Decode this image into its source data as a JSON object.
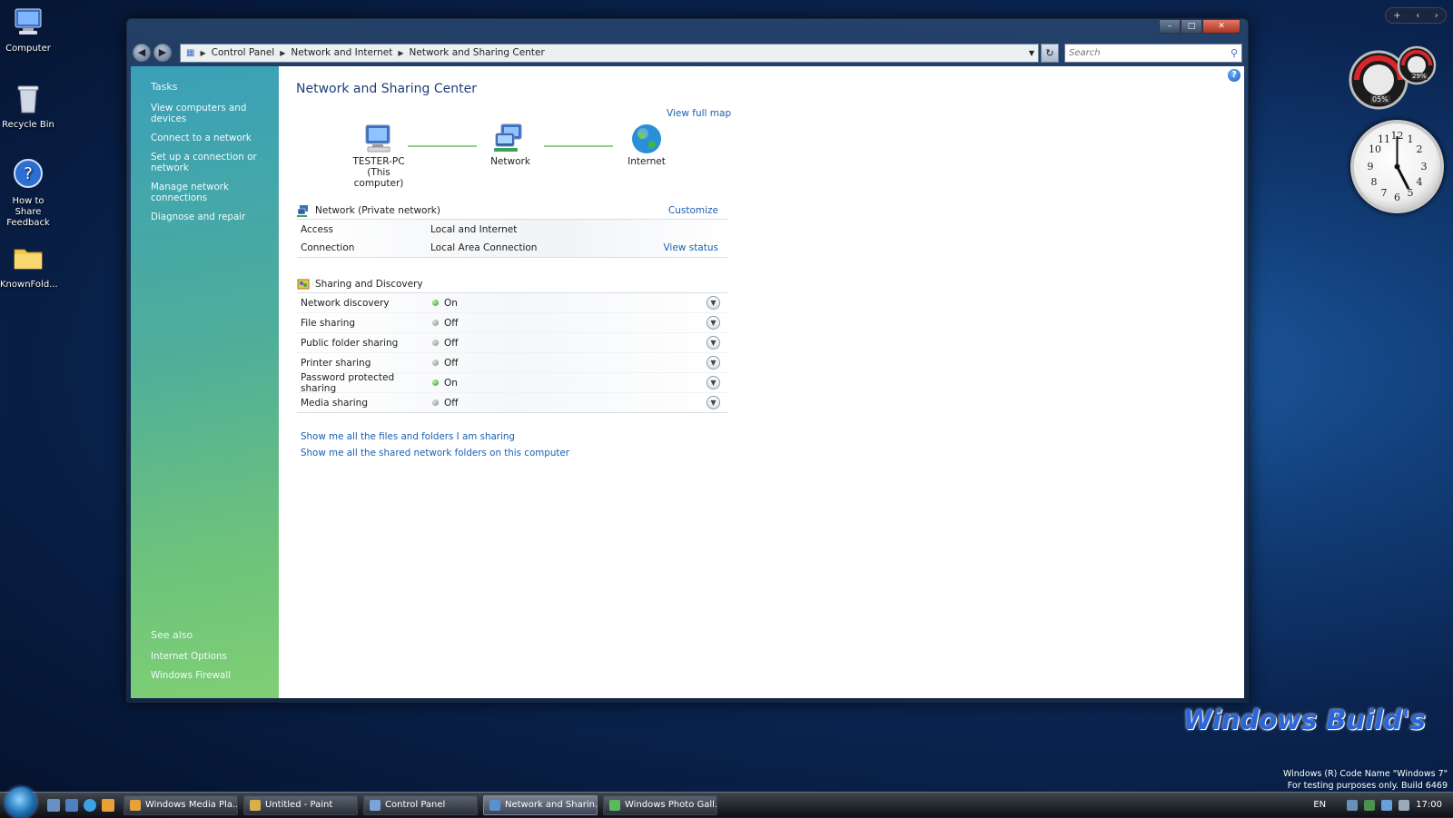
{
  "desktop": {
    "icons": [
      {
        "label": "Computer"
      },
      {
        "label": "Recycle Bin"
      },
      {
        "label": "How to Share Feedback"
      },
      {
        "label": "KnownFold..."
      }
    ]
  },
  "window": {
    "breadcrumb": [
      "Control Panel",
      "Network and Internet",
      "Network and Sharing Center"
    ],
    "search_placeholder": "Search",
    "sidebar": {
      "tasks_heading": "Tasks",
      "tasks": [
        "View computers and devices",
        "Connect to a network",
        "Set up a connection or network",
        "Manage network connections",
        "Diagnose and repair"
      ],
      "see_also_heading": "See also",
      "see_also": [
        "Internet Options",
        "Windows Firewall"
      ]
    },
    "main": {
      "title": "Network and Sharing Center",
      "view_full_map": "View full map",
      "map": {
        "computer_name": "TESTER-PC",
        "computer_sub": "(This computer)",
        "network": "Network",
        "internet": "Internet"
      },
      "network": {
        "name": "Network (Private network)",
        "customize": "Customize",
        "rows": [
          {
            "key": "Access",
            "value": "Local and Internet",
            "action": ""
          },
          {
            "key": "Connection",
            "value": "Local Area Connection",
            "action": "View status"
          }
        ]
      },
      "sharing": {
        "heading": "Sharing and Discovery",
        "rows": [
          {
            "key": "Network discovery",
            "state": "On"
          },
          {
            "key": "File sharing",
            "state": "Off"
          },
          {
            "key": "Public folder sharing",
            "state": "Off"
          },
          {
            "key": "Printer sharing",
            "state": "Off"
          },
          {
            "key": "Password protected sharing",
            "state": "On"
          },
          {
            "key": "Media sharing",
            "state": "Off"
          }
        ]
      },
      "links": [
        "Show me all the files and folders I am sharing",
        "Show me all the shared network folders on this computer"
      ]
    }
  },
  "gadgets": {
    "cpu_percent": "05%",
    "ram_percent": "29%"
  },
  "watermark": "Windows Build's",
  "build_info": {
    "line1": "Windows (R) Code Name \"Windows 7\"",
    "line2": "For testing purposes only. Build 6469"
  },
  "taskbar": {
    "tasks": [
      {
        "label": "Windows Media Pla...",
        "active": false
      },
      {
        "label": "Untitled - Paint",
        "active": false
      },
      {
        "label": "Control Panel",
        "active": false
      },
      {
        "label": "Network and Sharin...",
        "active": true
      },
      {
        "label": "Windows Photo Gall...",
        "active": false
      }
    ],
    "language": "EN",
    "time": "17:00"
  },
  "colors": {
    "link": "#1a5fb4",
    "title": "#1e3f7a",
    "status_on": "#2e9c1d",
    "status_off": "#8a8a8a"
  }
}
